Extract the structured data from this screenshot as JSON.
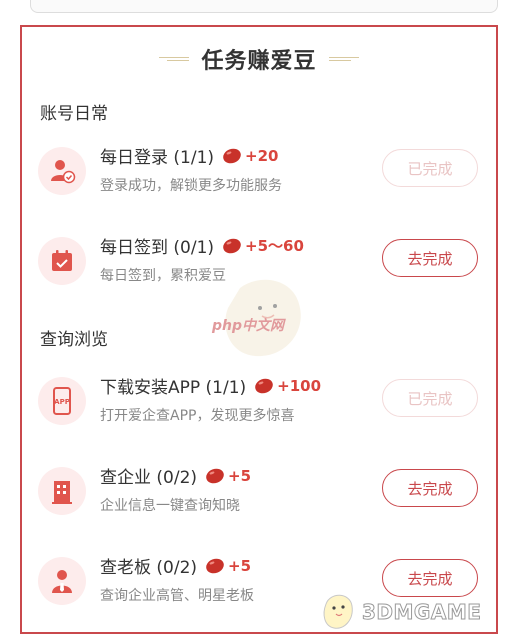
{
  "page": {
    "title": "任务赚爱豆",
    "accent_color": "#c9484c",
    "reward_color": "#d9453d"
  },
  "sections": [
    {
      "title": "账号日常",
      "tasks": [
        {
          "name": "每日登录 (1/1)",
          "reward": "+20",
          "desc": "登录成功，解锁更多功能服务",
          "button": "已完成",
          "status": "done",
          "icon": "user-check-icon"
        },
        {
          "name": "每日签到 (0/1)",
          "reward": "+5～60",
          "desc": "每日签到，累积爱豆",
          "button": "去完成",
          "status": "todo",
          "icon": "calendar-check-icon"
        }
      ]
    },
    {
      "title": "查询浏览",
      "tasks": [
        {
          "name": "下载安装APP (1/1)",
          "reward": "+100",
          "desc": "打开爱企查APP，发现更多惊喜",
          "button": "已完成",
          "status": "done",
          "icon": "app-phone-icon"
        },
        {
          "name": "查企业 (0/2)",
          "reward": "+5",
          "desc": "企业信息一键查询知晓",
          "button": "去完成",
          "status": "todo",
          "icon": "building-icon"
        },
        {
          "name": "查老板 (0/2)",
          "reward": "+5",
          "desc": "查询企业高管、明星老板",
          "button": "去完成",
          "status": "todo",
          "icon": "boss-icon"
        }
      ]
    }
  ],
  "watermarks": {
    "php": "php中文网",
    "game": "3DMGAME"
  }
}
